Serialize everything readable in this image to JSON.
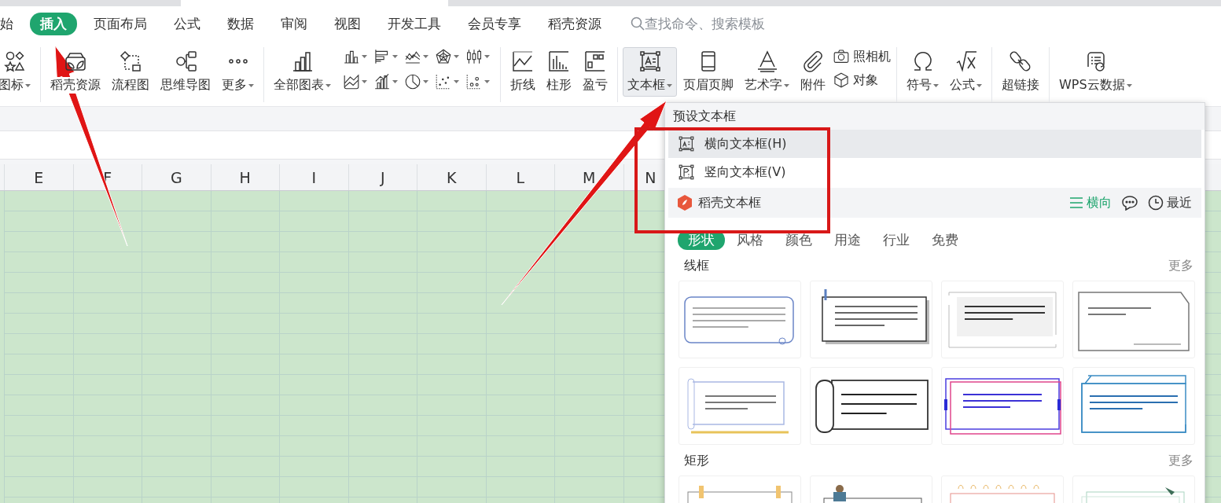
{
  "tab_bar": {
    "tabs": [
      {
        "label": "始",
        "selected": false
      },
      {
        "label": "插入",
        "selected": true
      },
      {
        "label": "页面布局",
        "selected": false
      },
      {
        "label": "公式",
        "selected": false
      },
      {
        "label": "数据",
        "selected": false
      },
      {
        "label": "审阅",
        "selected": false
      },
      {
        "label": "视图",
        "selected": false
      },
      {
        "label": "开发工具",
        "selected": false
      },
      {
        "label": "会员专享",
        "selected": false
      },
      {
        "label": "稻壳资源",
        "selected": false
      }
    ],
    "search": {
      "placeholder": "查找命令、搜索模板"
    }
  },
  "ribbon": {
    "groups": [
      {
        "items": [
          {
            "kind": "large",
            "label": "图标",
            "dropdown": true,
            "selected": false
          }
        ]
      },
      {
        "items": [
          {
            "kind": "large",
            "label": "稻壳资源",
            "dropdown": false,
            "selected": false
          },
          {
            "kind": "large",
            "label": "流程图",
            "dropdown": false,
            "selected": false
          },
          {
            "kind": "large",
            "label": "思维导图",
            "dropdown": false,
            "selected": false
          },
          {
            "kind": "large",
            "label": "更多",
            "dropdown": true,
            "selected": false
          }
        ]
      },
      {
        "items": [
          {
            "kind": "large",
            "label": "全部图表",
            "dropdown": true,
            "selected": false
          },
          {
            "kind": "chart-grid"
          }
        ]
      },
      {
        "items": [
          {
            "kind": "large",
            "label": "折线",
            "dropdown": false,
            "selected": false
          },
          {
            "kind": "large",
            "label": "柱形",
            "dropdown": false,
            "selected": false
          },
          {
            "kind": "large",
            "label": "盈亏",
            "dropdown": false,
            "selected": false
          }
        ]
      },
      {
        "items": [
          {
            "kind": "large",
            "label": "文本框",
            "dropdown": true,
            "selected": true
          },
          {
            "kind": "large",
            "label": "页眉页脚",
            "dropdown": false,
            "selected": false
          },
          {
            "kind": "large",
            "label": "艺术字",
            "dropdown": true,
            "selected": false
          },
          {
            "kind": "large",
            "label": "附件",
            "dropdown": false,
            "selected": false
          },
          {
            "kind": "stack",
            "items": [
              {
                "label": "照相机"
              },
              {
                "label": "对象"
              }
            ]
          }
        ]
      },
      {
        "items": [
          {
            "kind": "large",
            "label": "符号",
            "dropdown": true,
            "selected": false
          },
          {
            "kind": "large",
            "label": "公式",
            "dropdown": true,
            "selected": false
          }
        ]
      },
      {
        "items": [
          {
            "kind": "large",
            "label": "超链接",
            "dropdown": false,
            "selected": false
          }
        ]
      },
      {
        "items": [
          {
            "kind": "large",
            "label": "WPS云数据",
            "dropdown": true,
            "selected": false
          }
        ]
      }
    ]
  },
  "sheet": {
    "columns": [
      "E",
      "F",
      "G",
      "H",
      "I",
      "J",
      "K",
      "L",
      "M",
      "N"
    ]
  },
  "textbox_menu": {
    "header": "预设文本框",
    "items": [
      {
        "label": "横向文本框(H)",
        "selected": true
      },
      {
        "label": "竖向文本框(V)",
        "selected": false
      }
    ],
    "docer_bar": {
      "label": "稻壳文本框",
      "layout": "横向",
      "recent": "最近"
    },
    "categories": [
      {
        "label": "形状",
        "selected": true
      },
      {
        "label": "风格",
        "selected": false
      },
      {
        "label": "颜色",
        "selected": false
      },
      {
        "label": "用途",
        "selected": false
      },
      {
        "label": "行业",
        "selected": false
      },
      {
        "label": "免费",
        "selected": false
      }
    ],
    "sections": [
      {
        "title": "线框",
        "more": "更多",
        "templates": [
          {
            "kind": "rounded"
          },
          {
            "kind": "shadow"
          },
          {
            "kind": "bracket"
          },
          {
            "kind": "notched"
          },
          {
            "kind": "scroll"
          },
          {
            "kind": "scroll-bold"
          },
          {
            "kind": "neon"
          },
          {
            "kind": "tech"
          }
        ]
      },
      {
        "title": "矩形",
        "more": "更多",
        "templates": [
          {
            "kind": "pinned"
          },
          {
            "kind": "figure"
          },
          {
            "kind": "spiral"
          },
          {
            "kind": "leaf"
          }
        ]
      }
    ]
  }
}
